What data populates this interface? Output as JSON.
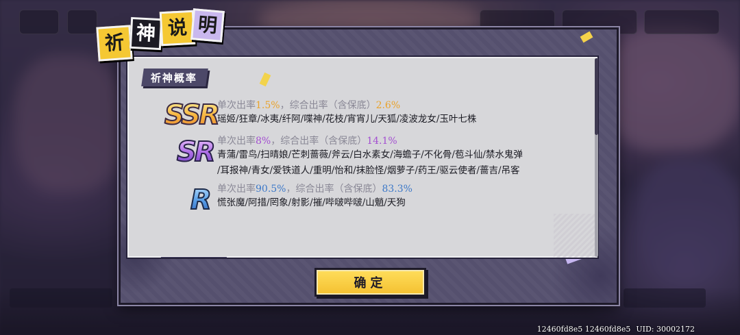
{
  "dialog": {
    "title_chars": [
      "祈",
      "神",
      "说",
      "明"
    ],
    "section_title": "祈神概率",
    "confirm_label": "确定"
  },
  "colors": {
    "ssr_rate": "#e9a22a",
    "sr_rate": "#a34fd1",
    "r_rate": "#3c78c8",
    "confirm_button": "#f4c030",
    "panel_bg": "#d7d7da"
  },
  "rarities": [
    {
      "badge": "SSR",
      "rate_prefix": "单次出率",
      "single_rate": "1.5%",
      "rate_middle": "，综合出率（含保底）",
      "total_rate": "2.6%",
      "names_lines": [
        "瑶姬/狂章/冰夷/纤阿/喋神/花枝/宵宵儿/天狐/凌波龙女/玉叶七株"
      ]
    },
    {
      "badge": "SR",
      "rate_prefix": "单次出率",
      "single_rate": "8%",
      "rate_middle": "，综合出率（含保底）",
      "total_rate": "14.1%",
      "names_lines": [
        "青蒲/雷鸟/扫晴娘/芒刺蔷薇/斧云/白水素女/海蟾子/不化骨/苞斗仙/禁水鬼弹",
        "/耳报神/青女/爱铁道人/重明/怡和/抹脸怪/烟萝子/药王/驱云使者/蔷吉/吊客"
      ]
    },
    {
      "badge": "R",
      "rate_prefix": "单次出率",
      "single_rate": "90.5%",
      "rate_middle": "，综合出率（含保底）",
      "total_rate": "83.3%",
      "names_lines": [
        "慌张魔/阿措/罔象/射影/摧/哔啵哔啵/山魈/天狗"
      ]
    }
  ],
  "footer": {
    "ids": "12460fd8e5 12460fd8e5",
    "uid": "UID:  30002172"
  }
}
